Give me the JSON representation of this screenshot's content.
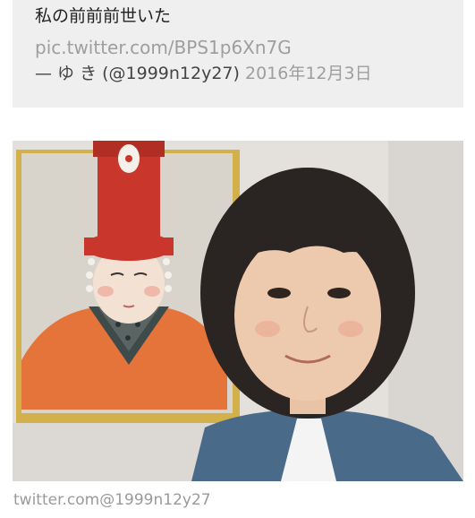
{
  "tweet": {
    "text": "私の前前前世いた",
    "link": "pic.twitter.com/BPS1p6Xn7G",
    "author": "— ゆ き (@1999n12y27)",
    "date": "2016年12月3日"
  },
  "photo": {
    "subject": "selfie-with-portrait-painting"
  },
  "credit": "twitter.com@1999n12y27",
  "colors": {
    "card_background": "#efefef",
    "link_gray": "#9e9e9e",
    "hat_red": "#c9362b",
    "robe_orange": "#e5743a",
    "frame_gold": "#d4b04a"
  }
}
